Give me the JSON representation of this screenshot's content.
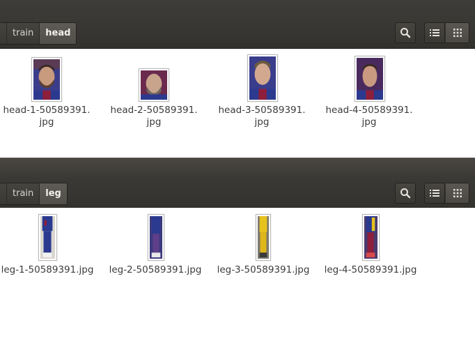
{
  "windows": [
    {
      "path": [
        "",
        "train",
        "head"
      ],
      "files": [
        {
          "name_line1": "head-1-50589391.",
          "name_line2": "jpg",
          "thumb_icon": "face-photo-icon"
        },
        {
          "name_line1": "head-2-50589391.",
          "name_line2": "jpg",
          "thumb_icon": "face-photo-icon"
        },
        {
          "name_line1": "head-3-50589391.",
          "name_line2": "jpg",
          "thumb_icon": "face-photo-icon"
        },
        {
          "name_line1": "head-4-50589391.",
          "name_line2": "jpg",
          "thumb_icon": "face-photo-icon"
        }
      ]
    },
    {
      "path": [
        "",
        "train",
        "leg"
      ],
      "files": [
        {
          "name": "leg-1-50589391.jpg",
          "thumb_icon": "leg-photo-icon"
        },
        {
          "name": "leg-2-50589391.jpg",
          "thumb_icon": "leg-photo-icon"
        },
        {
          "name": "leg-3-50589391.jpg",
          "thumb_icon": "leg-photo-icon"
        },
        {
          "name": "leg-4-50589391.jpg",
          "thumb_icon": "leg-photo-icon"
        }
      ]
    }
  ],
  "toolbar_icons": {
    "search": "search-icon",
    "list_view": "list-view-icon",
    "grid_view": "grid-view-icon"
  },
  "colors": {
    "header": "#3c3a36",
    "content": "#ffffff",
    "text": "#3c3c3c",
    "kit_blue": "#2b3a8f",
    "kit_red": "#8e1f3c",
    "kit_yellow": "#e8c21c"
  }
}
